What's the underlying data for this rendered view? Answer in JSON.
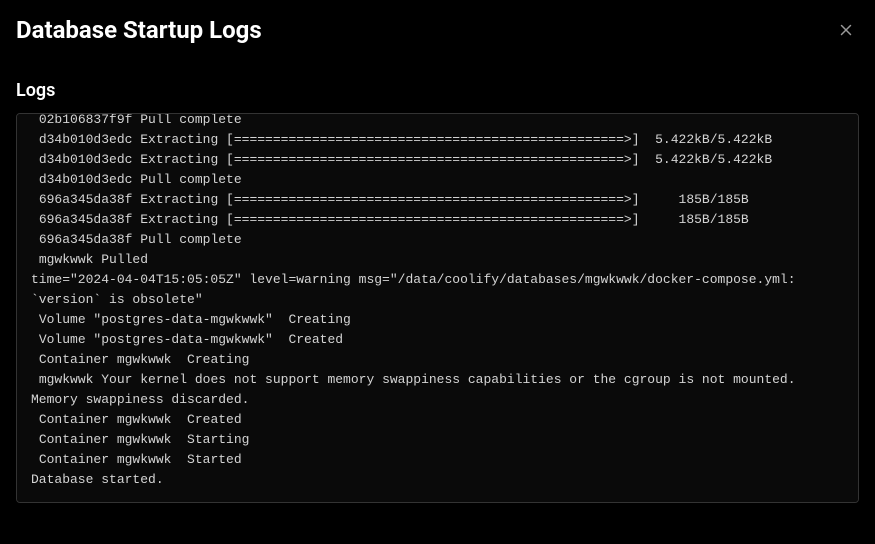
{
  "header": {
    "title": "Database Startup Logs"
  },
  "section": {
    "label": "Logs"
  },
  "logs": " 02b106837f9f Pull complete\n d34b010d3edc Extracting [==================================================>]  5.422kB/5.422kB\n d34b010d3edc Extracting [==================================================>]  5.422kB/5.422kB\n d34b010d3edc Pull complete\n 696a345da38f Extracting [==================================================>]     185B/185B\n 696a345da38f Extracting [==================================================>]     185B/185B\n 696a345da38f Pull complete\n mgwkwwk Pulled\ntime=\"2024-04-04T15:05:05Z\" level=warning msg=\"/data/coolify/databases/mgwkwwk/docker-compose.yml: `version` is obsolete\"\n Volume \"postgres-data-mgwkwwk\"  Creating\n Volume \"postgres-data-mgwkwwk\"  Created\n Container mgwkwwk  Creating\n mgwkwwk Your kernel does not support memory swappiness capabilities or the cgroup is not mounted. Memory swappiness discarded.\n Container mgwkwwk  Created\n Container mgwkwwk  Starting\n Container mgwkwwk  Started\nDatabase started."
}
